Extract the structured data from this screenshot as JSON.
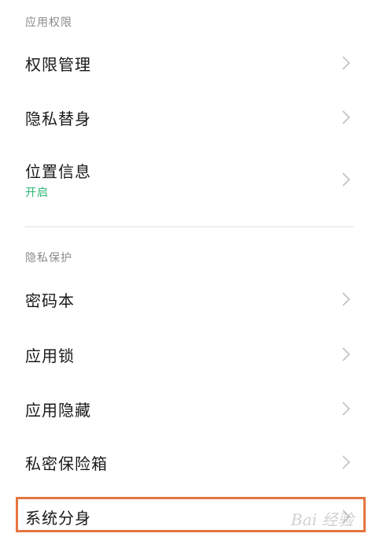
{
  "sections": {
    "app_permissions": {
      "header": "应用权限",
      "items": [
        {
          "label": "权限管理"
        },
        {
          "label": "隐私替身"
        },
        {
          "label": "位置信息",
          "status": "开启"
        }
      ]
    },
    "privacy_protection": {
      "header": "隐私保护",
      "items": [
        {
          "label": "密码本"
        },
        {
          "label": "应用锁"
        },
        {
          "label": "应用隐藏"
        },
        {
          "label": "私密保险箱"
        },
        {
          "label": "系统分身"
        }
      ]
    }
  },
  "watermark": "Bai 经验",
  "colors": {
    "status_green": "#2bb673",
    "highlight_orange": "#e5763f",
    "header_gray": "#8a8a8a"
  },
  "icons": {
    "row_chevron": "chevron-right-icon"
  }
}
